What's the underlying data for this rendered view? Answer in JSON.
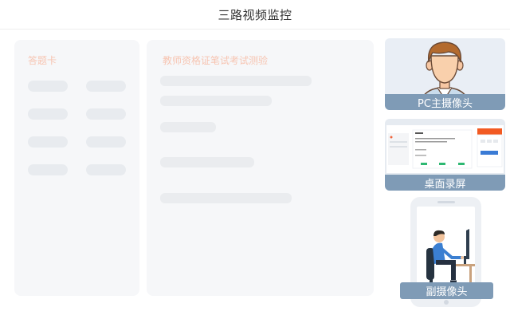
{
  "header": {
    "title": "三路视频监控"
  },
  "answer_card": {
    "title": "答题卡"
  },
  "exam": {
    "title": "教师资格证笔试考试测验"
  },
  "cameras": {
    "main": {
      "label": "PC主摄像头",
      "icon": "person-avatar-icon"
    },
    "screen": {
      "label": "桌面录屏",
      "icon": "desktop-screenshot-icon"
    },
    "secondary": {
      "label": "副摄像头",
      "icon": "person-at-desk-icon"
    }
  },
  "colors": {
    "accent": "#7f9bb6",
    "placeholder_title": "#f7c4b1",
    "panel_bg": "#f6f7f9"
  }
}
